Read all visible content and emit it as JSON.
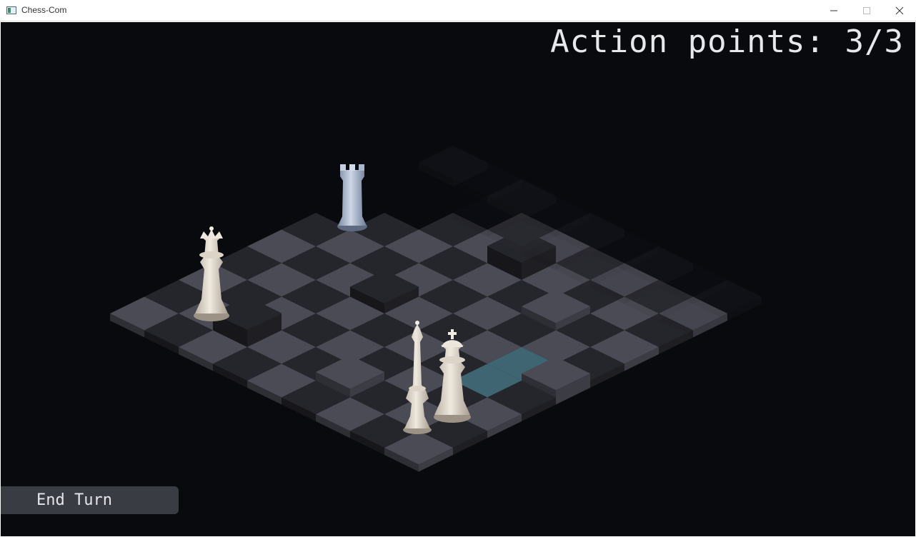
{
  "window": {
    "title": "Chess-Com",
    "controls": [
      "minimize",
      "maximize",
      "close"
    ]
  },
  "hud": {
    "action_points_label": "Action points: 3/3",
    "end_turn_label": "End Turn"
  },
  "board": {
    "colors": {
      "light": "#4a4b55",
      "dark": "#25252c",
      "highlight": "#3f6472",
      "background": "#080a0e"
    },
    "pieces": [
      {
        "type": "queen",
        "color": "white",
        "square": "a5"
      },
      {
        "type": "rook",
        "color": "blue",
        "square": "b8"
      },
      {
        "type": "king",
        "color": "white",
        "square": "e3"
      },
      {
        "type": "bishop",
        "color": "white",
        "square": "e1"
      }
    ]
  }
}
